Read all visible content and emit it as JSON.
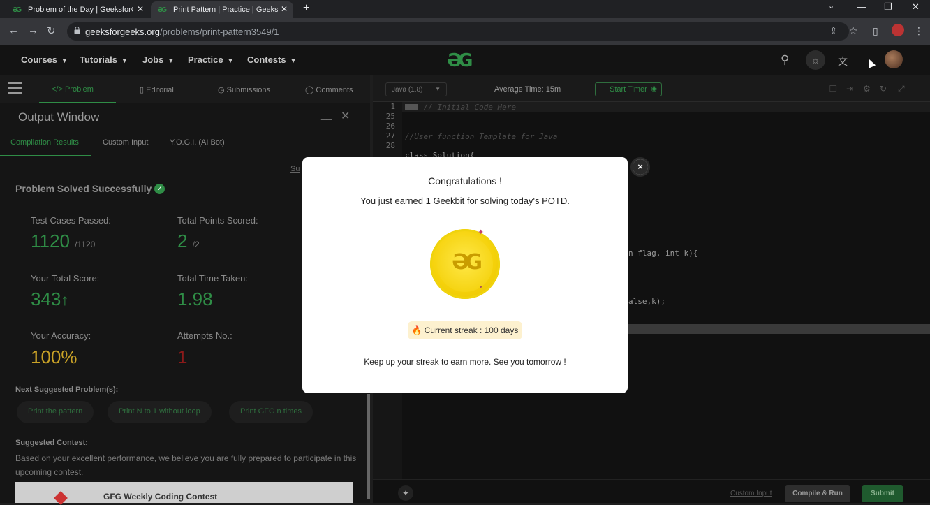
{
  "browser": {
    "tabs": [
      {
        "title": "Problem of the Day | GeeksforGe",
        "active": false
      },
      {
        "title": "Print Pattern | Practice | Geeksfo",
        "active": true
      }
    ],
    "new_tab": "+",
    "url_host": "geeksforgeeks.org",
    "url_path": "/problems/print-pattern3549/1"
  },
  "site": {
    "menus": [
      "Courses",
      "Tutorials",
      "Jobs",
      "Practice",
      "Contests"
    ],
    "logo": "ƏG"
  },
  "problem_tabs": [
    "</> Problem",
    "Editorial",
    "Submissions",
    "Comments"
  ],
  "output": {
    "title": "Output Window",
    "tabs": [
      "Compilation Results",
      "Custom Input",
      "Y.O.G.I. (AI Bot)"
    ],
    "submission_link": "Su",
    "status": "Problem Solved Successfully",
    "test_cases_label": "Test Cases Passed:",
    "test_cases_value": "1120",
    "test_cases_total": "/1120",
    "points_label": "Total Points Scored:",
    "points_value": "2",
    "points_total": "/2",
    "score_label": "Your Total Score:",
    "score_value": "343",
    "time_label": "Total Time Taken:",
    "time_value": "1.98",
    "accuracy_label": "Your Accuracy:",
    "accuracy_value": "100%",
    "attempts_label": "Attempts No.:",
    "attempts_value": "1",
    "next_label": "Next Suggested Problem(s):",
    "suggestions": [
      "Print the pattern",
      "Print N to 1 without loop",
      "Print GFG n times"
    ],
    "contest_label": "Suggested Contest:",
    "contest_desc": "Based on your excellent performance, we believe you are fully prepared to participate in this upcoming contest.",
    "contest_name": "GFG Weekly Coding Contest"
  },
  "editor": {
    "language": "Java (1.8)",
    "avg_time": "Average Time: 15m",
    "start_timer": "Start Timer",
    "lines": [
      {
        "n": "1",
        "text": "    // Initial Code Here",
        "comment": true
      },
      {
        "n": "25",
        "text": "",
        "comment": false
      },
      {
        "n": "26",
        "text": "",
        "comment": false
      },
      {
        "n": "27",
        "text": "//User function Template for Java",
        "comment": true
      },
      {
        "n": "28",
        "text": "class Solution{",
        "comment": false
      }
    ],
    "code_fragment_1": "n flag, int k){",
    "code_fragment_2": "alse,k);",
    "custom_input": "Custom Input",
    "compile_run": "Compile & Run",
    "submit": "Submit"
  },
  "modal": {
    "heading": "Congratulations !",
    "earned": "You just earned 1 Geekbit for solving today's POTD.",
    "streak": "Current streak : 100 days",
    "footer": "Keep up your streak to earn more. See you tomorrow !",
    "close": "×"
  },
  "colors": {
    "brand_green": "#2f8d46",
    "accuracy_yellow": "#c9a227",
    "attempts_red": "#8b1a1a",
    "coin_gold": "#f5d20b"
  }
}
